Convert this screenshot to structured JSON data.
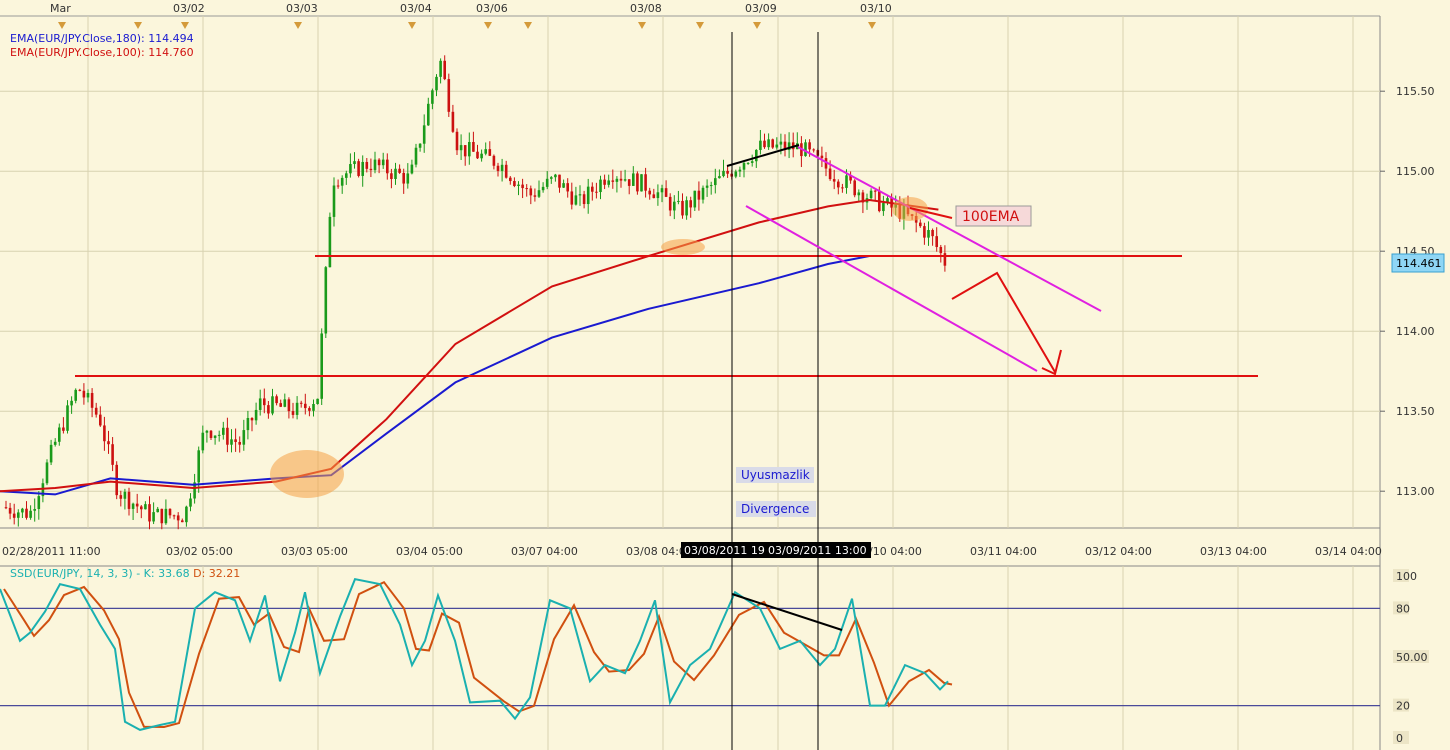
{
  "chart_data": {
    "type": "candlestick",
    "symbol": "EUR/JPY",
    "top_dates": [
      "Mar",
      "03/02",
      "03/03",
      "03/04",
      "03/06",
      "03/08",
      "03/09",
      "03/10"
    ],
    "x_time_labels": [
      "02/28/2011 11:00",
      "03/02 05:00",
      "03/03 05:00",
      "03/04 05:00",
      "03/07 04:00",
      "03/08 04:00",
      "03/10 04:00",
      "03/11 04:00",
      "03/12 04:00",
      "03/13 04:00",
      "03/14 04:00"
    ],
    "crosshair_labels": [
      "03/08/2011 19:00",
      "03/09/2011 13:00"
    ],
    "y_ticks": [
      "115.50",
      "115.00",
      "114.50",
      "114.00",
      "113.50",
      "113.00"
    ],
    "ylim": [
      112.77,
      115.97
    ],
    "last_price": "114.461",
    "indicators": {
      "ema180": {
        "label": "EMA(EUR/JPY.Close,180)",
        "value": "114.494",
        "color": "#1a1ad0"
      },
      "ema100": {
        "label": "EMA(EUR/JPY.Close,100)",
        "value": "114.760",
        "color": "#d11010"
      }
    },
    "annotations": {
      "ema_box": "100EMA",
      "divergence_tr": "Uyusmazlik",
      "divergence_en": "Divergence"
    },
    "horizontal_levels": [
      114.47,
      113.72
    ],
    "ema100_points": [
      [
        0,
        113.0
      ],
      [
        0.04,
        113.02
      ],
      [
        0.08,
        113.06
      ],
      [
        0.14,
        113.02
      ],
      [
        0.2,
        113.06
      ],
      [
        0.24,
        113.14
      ],
      [
        0.28,
        113.45
      ],
      [
        0.33,
        113.92
      ],
      [
        0.4,
        114.28
      ],
      [
        0.47,
        114.47
      ],
      [
        0.55,
        114.68
      ],
      [
        0.6,
        114.78
      ],
      [
        0.63,
        114.82
      ],
      [
        0.68,
        114.76
      ]
    ],
    "ema180_points": [
      [
        0,
        113.0
      ],
      [
        0.04,
        112.98
      ],
      [
        0.08,
        113.08
      ],
      [
        0.14,
        113.04
      ],
      [
        0.2,
        113.08
      ],
      [
        0.24,
        113.1
      ],
      [
        0.28,
        113.36
      ],
      [
        0.33,
        113.68
      ],
      [
        0.4,
        113.96
      ],
      [
        0.47,
        114.14
      ],
      [
        0.55,
        114.3
      ],
      [
        0.6,
        114.42
      ],
      [
        0.63,
        114.47
      ]
    ],
    "stochastic": {
      "label": "SSD(EUR/JPY, 14, 3, 3)",
      "k_label": "K: 33.68",
      "d_label": "D: 32.21",
      "k_value": 33.68,
      "d_value": 32.21,
      "levels": [
        80,
        20
      ],
      "ticks": [
        "100",
        "80",
        "50.00",
        "20",
        "0"
      ],
      "ylim": [
        0,
        100
      ],
      "k_color": "#1ab0b0",
      "d_color": "#d05010"
    }
  }
}
